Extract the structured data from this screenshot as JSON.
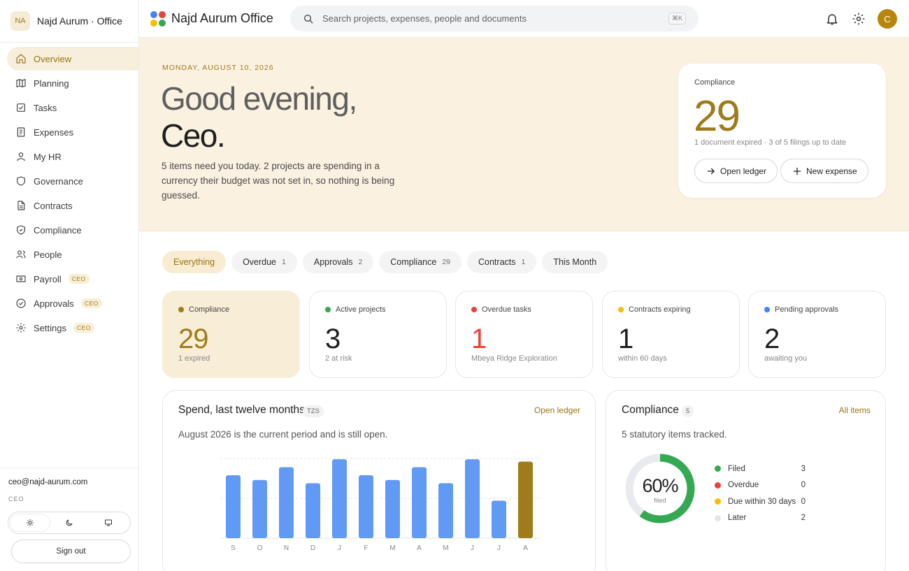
{
  "brand": {
    "initials": "NA",
    "name": "Najd Aurum · Office"
  },
  "sidebar": {
    "items": [
      {
        "label": "Overview",
        "icon": "home-icon"
      },
      {
        "label": "Planning",
        "icon": "map-icon"
      },
      {
        "label": "Tasks",
        "icon": "checkbox-icon"
      },
      {
        "label": "Expenses",
        "icon": "receipt-icon"
      },
      {
        "label": "My HR",
        "icon": "person-icon"
      },
      {
        "label": "Governance",
        "icon": "shield-icon"
      },
      {
        "label": "Contracts",
        "icon": "document-icon"
      },
      {
        "label": "Compliance",
        "icon": "shield-check-icon"
      },
      {
        "label": "People",
        "icon": "people-icon"
      },
      {
        "label": "Payroll",
        "icon": "banknote-icon",
        "tag": "CEO"
      },
      {
        "label": "Approvals",
        "icon": "check-circle-icon",
        "tag": "CEO"
      },
      {
        "label": "Settings",
        "icon": "gear-icon",
        "tag": "CEO"
      }
    ]
  },
  "account": {
    "email": "ceo@najd-aurum.com",
    "role": "CEO",
    "sign_out": "Sign out"
  },
  "header": {
    "title": "Najd Aurum Office",
    "search_placeholder": "Search projects, expenses, people and documents",
    "shortcut": "⌘K",
    "avatar_initial": "C"
  },
  "hero": {
    "date": "MONDAY, AUGUST 10, 2026",
    "greeting_line1": "Good evening,",
    "greeting_line2": "Ceo.",
    "message": "5 items need you today. 2 projects are spending in a currency their budget was not set in, so nothing is being guessed.",
    "card": {
      "label": "Compliance",
      "value": "29",
      "sub": "1 document expired · 3 of 5 filings up to date",
      "open_ledger": "Open ledger",
      "new_expense": "New expense"
    }
  },
  "filters": [
    {
      "label": "Everything",
      "count": ""
    },
    {
      "label": "Overdue",
      "count": "1"
    },
    {
      "label": "Approvals",
      "count": "2"
    },
    {
      "label": "Compliance",
      "count": "29"
    },
    {
      "label": "Contracts",
      "count": "1"
    },
    {
      "label": "This Month",
      "count": ""
    }
  ],
  "stats": [
    {
      "label": "Compliance",
      "value": "29",
      "sub": "1 expired",
      "color": "#a07b1a",
      "value_color": "#a07b1a"
    },
    {
      "label": "Active projects",
      "value": "3",
      "sub": "2 at risk",
      "color": "#34a853",
      "value_color": "#1f1f1f"
    },
    {
      "label": "Overdue tasks",
      "value": "1",
      "sub": "Mbeya Ridge Exploration",
      "color": "#ea4335",
      "value_color": "#ea4335"
    },
    {
      "label": "Contracts expiring",
      "value": "1",
      "sub": "within 60 days",
      "color": "#fbbc04",
      "value_color": "#1f1f1f"
    },
    {
      "label": "Pending approvals",
      "value": "2",
      "sub": "awaiting you",
      "color": "#4285f4",
      "value_color": "#1f1f1f"
    }
  ],
  "spend": {
    "title": "Spend, last twelve months",
    "currency": "TZS",
    "link": "Open ledger",
    "note": "August 2026 is the current period and is still open."
  },
  "chart_data": {
    "type": "bar",
    "categories": [
      "S",
      "O",
      "N",
      "D",
      "J",
      "F",
      "M",
      "A",
      "M",
      "J",
      "J",
      "A"
    ],
    "values": [
      0.79,
      0.73,
      0.89,
      0.69,
      0.99,
      0.79,
      0.73,
      0.89,
      0.69,
      0.99,
      0.47,
      0.96
    ],
    "colors": {
      "bar": "#619af4",
      "current": "#a07b1a"
    },
    "grid": true
  },
  "compliance": {
    "title": "Compliance",
    "count": "5",
    "link": "All items",
    "note": "5 statutory items tracked.",
    "percent_label": "60%",
    "percent_caption": "filed",
    "filled_fraction": 0.6,
    "legend": [
      {
        "label": "Filed",
        "value": "3",
        "color": "#34a853"
      },
      {
        "label": "Overdue",
        "value": "0",
        "color": "#ea4335"
      },
      {
        "label": "Due within 30 days",
        "value": "0",
        "color": "#fbbc04"
      },
      {
        "label": "Later",
        "value": "2",
        "color": "#e6e6e6"
      }
    ]
  }
}
